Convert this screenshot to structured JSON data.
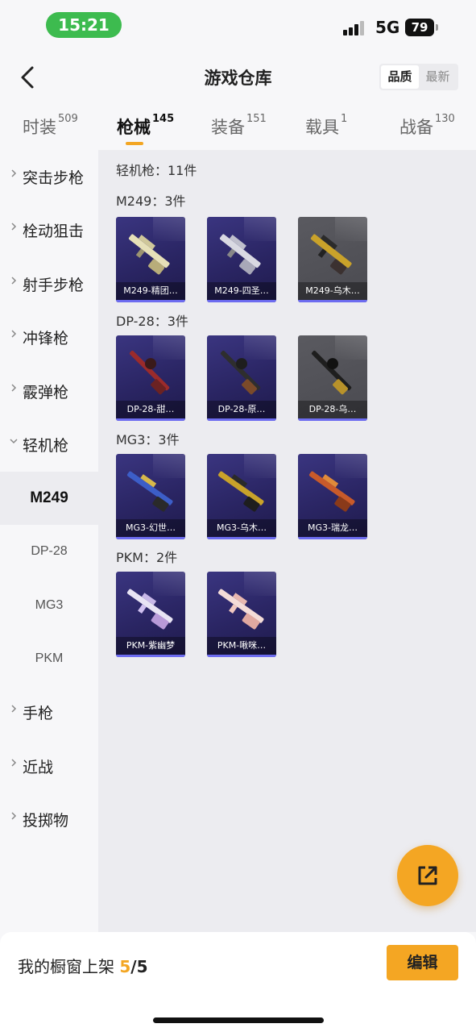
{
  "status_bar": {
    "time": "15:21",
    "network": "5G",
    "battery": "79"
  },
  "header": {
    "title": "游戏仓库",
    "sort_options": [
      "品质",
      "最新"
    ]
  },
  "tabs": [
    {
      "label": "时装",
      "count": "509"
    },
    {
      "label": "枪械",
      "count": "145"
    },
    {
      "label": "装备",
      "count": "151"
    },
    {
      "label": "载具",
      "count": "1"
    },
    {
      "label": "战备",
      "count": "130"
    }
  ],
  "sidebar": {
    "categories": [
      "突击步枪",
      "栓动狙击",
      "射手步枪",
      "冲锋枪",
      "霰弹枪",
      "轻机枪"
    ],
    "subcategories": [
      "M249",
      "DP-28",
      "MG3",
      "PKM"
    ],
    "more_categories": [
      "手枪",
      "近战",
      "投掷物"
    ]
  },
  "main": {
    "summary": "轻机枪：11件",
    "groups": [
      {
        "label": "M249：3件",
        "items": [
          "M249-精团…",
          "M249-四圣…",
          "M249-乌木…"
        ]
      },
      {
        "label": "DP-28：3件",
        "items": [
          "DP-28-甜…",
          "DP-28-原…",
          "DP-28-乌…"
        ]
      },
      {
        "label": "MG3：3件",
        "items": [
          "MG3-幻世…",
          "MG3-乌木…",
          "MG3-瑞龙…"
        ]
      },
      {
        "label": "PKM：2件",
        "items": [
          "PKM-紫幽梦",
          "PKM-啾咪…"
        ]
      }
    ]
  },
  "bottom": {
    "label": "我的橱窗上架",
    "current": "5",
    "total": "/5",
    "edit_label": "编辑"
  },
  "icons": {
    "back": "back-chevron-icon",
    "share": "share-external-icon"
  },
  "colors": {
    "accent": "#f4a623",
    "card_purple": "#2a2563",
    "status_green": "#3dbb4f"
  }
}
